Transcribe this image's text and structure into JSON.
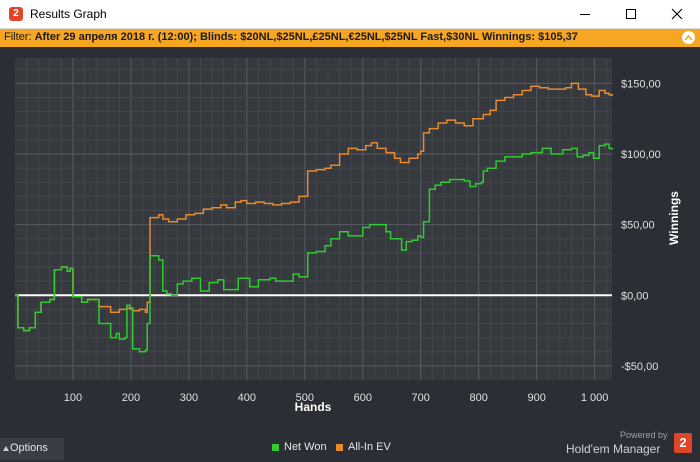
{
  "window": {
    "title": "Results Graph",
    "app_icon_text": "2",
    "controls": [
      "minimize-icon",
      "maximize-icon",
      "close-icon"
    ]
  },
  "filter": {
    "prefix": "Filter: ",
    "text": "After 29 апреля 2018 г. (12:00); Blinds: $20NL,$25NL,£25NL,€25NL,$25NL Fast,$30NL  Winnings: $105,37",
    "collapse_icon": "chevron-up-icon"
  },
  "options": {
    "label": "Options",
    "icon": "caret-up-icon"
  },
  "brand": {
    "powered": "Powered by",
    "name": "Hold'em Manager",
    "badge": "2"
  },
  "colors": {
    "net_won": "#2ecc2e",
    "allin_ev": "#e88a2e",
    "filter_bar": "#f5a623",
    "plot_bg": "#36393e",
    "zero_line": "#ffffff"
  },
  "chart_data": {
    "type": "line",
    "xlabel": "Hands",
    "ylabel": "Winnings",
    "xlim": [
      0,
      1030
    ],
    "ylim": [
      -60,
      168
    ],
    "xticks": [
      100,
      200,
      300,
      400,
      500,
      600,
      700,
      800,
      900,
      1000
    ],
    "xtick_labels": [
      "100",
      "200",
      "300",
      "400",
      "500",
      "600",
      "700",
      "800",
      "900",
      "1 000"
    ],
    "yticks": [
      -50,
      0,
      50,
      100,
      150
    ],
    "ytick_labels": [
      "-$50,00",
      "$0,00",
      "$50,00",
      "$100,00",
      "$150,00"
    ],
    "legend": "bottom-center",
    "grid": true,
    "series": [
      {
        "name": "Net Won",
        "color": "#2ecc2e",
        "points": [
          [
            0,
            0
          ],
          [
            5,
            -23
          ],
          [
            15,
            -25
          ],
          [
            25,
            -23
          ],
          [
            35,
            -12
          ],
          [
            45,
            -5
          ],
          [
            60,
            -3
          ],
          [
            68,
            18
          ],
          [
            80,
            20
          ],
          [
            90,
            17
          ],
          [
            95,
            19
          ],
          [
            100,
            -1
          ],
          [
            115,
            -5
          ],
          [
            125,
            -3
          ],
          [
            140,
            -3
          ],
          [
            145,
            -20
          ],
          [
            165,
            -30
          ],
          [
            175,
            -27
          ],
          [
            180,
            -31
          ],
          [
            190,
            -30
          ],
          [
            193,
            -7
          ],
          [
            198,
            -10
          ],
          [
            203,
            -38
          ],
          [
            215,
            -40
          ],
          [
            225,
            -39
          ],
          [
            228,
            -20
          ],
          [
            233,
            28
          ],
          [
            248,
            25
          ],
          [
            255,
            3
          ],
          [
            262,
            1
          ],
          [
            270,
            0
          ],
          [
            280,
            8
          ],
          [
            290,
            10
          ],
          [
            305,
            12
          ],
          [
            320,
            3
          ],
          [
            335,
            9
          ],
          [
            350,
            11
          ],
          [
            360,
            4
          ],
          [
            375,
            4
          ],
          [
            385,
            12
          ],
          [
            395,
            12
          ],
          [
            405,
            6
          ],
          [
            420,
            11
          ],
          [
            440,
            12
          ],
          [
            450,
            10
          ],
          [
            470,
            10
          ],
          [
            480,
            15
          ],
          [
            490,
            13
          ],
          [
            505,
            30
          ],
          [
            520,
            31
          ],
          [
            535,
            35
          ],
          [
            545,
            40
          ],
          [
            560,
            45
          ],
          [
            575,
            42
          ],
          [
            600,
            48
          ],
          [
            612,
            50
          ],
          [
            628,
            50
          ],
          [
            640,
            45
          ],
          [
            648,
            40
          ],
          [
            660,
            40
          ],
          [
            667,
            32
          ],
          [
            675,
            38
          ],
          [
            685,
            39
          ],
          [
            695,
            42
          ],
          [
            700,
            41
          ],
          [
            705,
            52
          ],
          [
            715,
            75
          ],
          [
            725,
            78
          ],
          [
            735,
            80
          ],
          [
            750,
            82
          ],
          [
            760,
            82
          ],
          [
            775,
            81
          ],
          [
            785,
            77
          ],
          [
            795,
            79
          ],
          [
            805,
            80
          ],
          [
            808,
            88
          ],
          [
            815,
            90
          ],
          [
            830,
            95
          ],
          [
            845,
            98
          ],
          [
            860,
            98
          ],
          [
            875,
            100
          ],
          [
            890,
            101
          ],
          [
            910,
            104
          ],
          [
            925,
            100
          ],
          [
            945,
            103
          ],
          [
            960,
            104
          ],
          [
            970,
            98
          ],
          [
            980,
            99
          ],
          [
            990,
            101
          ],
          [
            998,
            97
          ],
          [
            1008,
            106
          ],
          [
            1018,
            107
          ],
          [
            1025,
            104
          ],
          [
            1030,
            103
          ]
        ]
      },
      {
        "name": "All-In EV",
        "color": "#e88a2e",
        "points": [
          [
            0,
            0
          ],
          [
            5,
            -23
          ],
          [
            15,
            -25
          ],
          [
            25,
            -23
          ],
          [
            35,
            -12
          ],
          [
            45,
            -5
          ],
          [
            60,
            -3
          ],
          [
            68,
            18
          ],
          [
            80,
            20
          ],
          [
            90,
            17
          ],
          [
            95,
            19
          ],
          [
            100,
            -1
          ],
          [
            115,
            -5
          ],
          [
            125,
            -3
          ],
          [
            140,
            -3
          ],
          [
            145,
            -8
          ],
          [
            165,
            -12
          ],
          [
            175,
            -12
          ],
          [
            180,
            -10
          ],
          [
            193,
            -9
          ],
          [
            203,
            -11
          ],
          [
            215,
            -10
          ],
          [
            225,
            -12
          ],
          [
            228,
            -5
          ],
          [
            233,
            55
          ],
          [
            248,
            57
          ],
          [
            255,
            54
          ],
          [
            265,
            52
          ],
          [
            280,
            54
          ],
          [
            295,
            57
          ],
          [
            310,
            58
          ],
          [
            325,
            61
          ],
          [
            340,
            62
          ],
          [
            355,
            64
          ],
          [
            365,
            62
          ],
          [
            380,
            66
          ],
          [
            390,
            67
          ],
          [
            400,
            65
          ],
          [
            415,
            66
          ],
          [
            430,
            65
          ],
          [
            445,
            64
          ],
          [
            460,
            65
          ],
          [
            475,
            66
          ],
          [
            490,
            70
          ],
          [
            505,
            88
          ],
          [
            520,
            89
          ],
          [
            535,
            90
          ],
          [
            545,
            92
          ],
          [
            560,
            100
          ],
          [
            575,
            104
          ],
          [
            590,
            103
          ],
          [
            605,
            106
          ],
          [
            615,
            108
          ],
          [
            625,
            104
          ],
          [
            640,
            101
          ],
          [
            655,
            97
          ],
          [
            665,
            94
          ],
          [
            680,
            97
          ],
          [
            695,
            100
          ],
          [
            700,
            102
          ],
          [
            705,
            115
          ],
          [
            715,
            118
          ],
          [
            730,
            122
          ],
          [
            745,
            124
          ],
          [
            760,
            122
          ],
          [
            775,
            120
          ],
          [
            790,
            125
          ],
          [
            805,
            125
          ],
          [
            808,
            128
          ],
          [
            820,
            131
          ],
          [
            830,
            138
          ],
          [
            845,
            140
          ],
          [
            860,
            142
          ],
          [
            875,
            145
          ],
          [
            890,
            148
          ],
          [
            905,
            147
          ],
          [
            920,
            146
          ],
          [
            935,
            146
          ],
          [
            950,
            147
          ],
          [
            960,
            150
          ],
          [
            972,
            146
          ],
          [
            985,
            142
          ],
          [
            995,
            141
          ],
          [
            1008,
            145
          ],
          [
            1018,
            143
          ],
          [
            1025,
            142
          ],
          [
            1030,
            141
          ]
        ]
      }
    ]
  }
}
